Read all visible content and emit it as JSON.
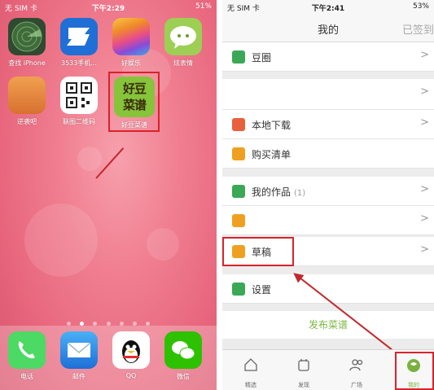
{
  "left_screen": {
    "status": {
      "carrier": "无 SIM 卡",
      "time": "下午2:29",
      "battery": "51%"
    },
    "apps_row1": [
      {
        "label": "查找 iPhone",
        "icon": "find-iphone-icon",
        "color": "#3d5b3d"
      },
      {
        "label": "3533手机...",
        "icon": "3533-icon",
        "color": "#1f6fd6"
      },
      {
        "label": "好娱乐",
        "icon": "rainbow-icon",
        "color": "#f0a020"
      },
      {
        "label": "炫表情",
        "icon": "chat-bubble-icon",
        "color": "#8bbf45"
      }
    ],
    "apps_row2": [
      {
        "label": "逆袭吧",
        "icon": "cartoon-icon",
        "color": "#e0893a"
      },
      {
        "label": "联图二维码",
        "icon": "qr-code-icon",
        "color": "#ffffff"
      },
      {
        "label": "好豆菜谱",
        "icon": "haodou-icon",
        "color": "#8cc63f",
        "icon_text": "好豆菜谱"
      }
    ],
    "dock": [
      {
        "label": "电话",
        "icon": "phone-icon",
        "color": "#4cd964"
      },
      {
        "label": "邮件",
        "icon": "mail-icon",
        "color": "#1e88e5"
      },
      {
        "label": "QQ",
        "icon": "qq-penguin-icon",
        "color": "#ffffff"
      },
      {
        "label": "微信",
        "icon": "wechat-icon",
        "color": "#2dc100"
      }
    ]
  },
  "right_screen": {
    "status": {
      "carrier": "无 SIM 卡",
      "time": "下午2:41",
      "battery": "53%"
    },
    "nav": {
      "title": "我的",
      "right": "已签到"
    },
    "rows": [
      {
        "label": "豆圈",
        "icon_color": "#3aa856",
        "count": ""
      },
      {
        "label": "",
        "icon_color": "",
        "count": ""
      },
      {
        "label": "本地下载",
        "icon_color": "#e8603c",
        "count": ""
      },
      {
        "label": "购买清单",
        "icon_color": "#f0a020",
        "count": ""
      },
      {
        "label": "我的作品",
        "icon_color": "#3aa856",
        "count": "(1)"
      },
      {
        "label": "",
        "icon_color": "#f0a020",
        "count": ""
      },
      {
        "label": "草稿",
        "icon_color": "#f0a020",
        "count": ""
      },
      {
        "label": "设置",
        "icon_color": "#3aa856",
        "count": ""
      }
    ],
    "publish_label": "发布菜谱",
    "tabs": [
      {
        "label": "精选",
        "icon": "home-icon"
      },
      {
        "label": "发现",
        "icon": "discover-icon"
      },
      {
        "label": "广场",
        "icon": "people-icon"
      },
      {
        "label": "我的",
        "icon": "haodou-bean-icon"
      }
    ],
    "accent_color": "#79b13f",
    "highlight_color": "#d8232a"
  }
}
